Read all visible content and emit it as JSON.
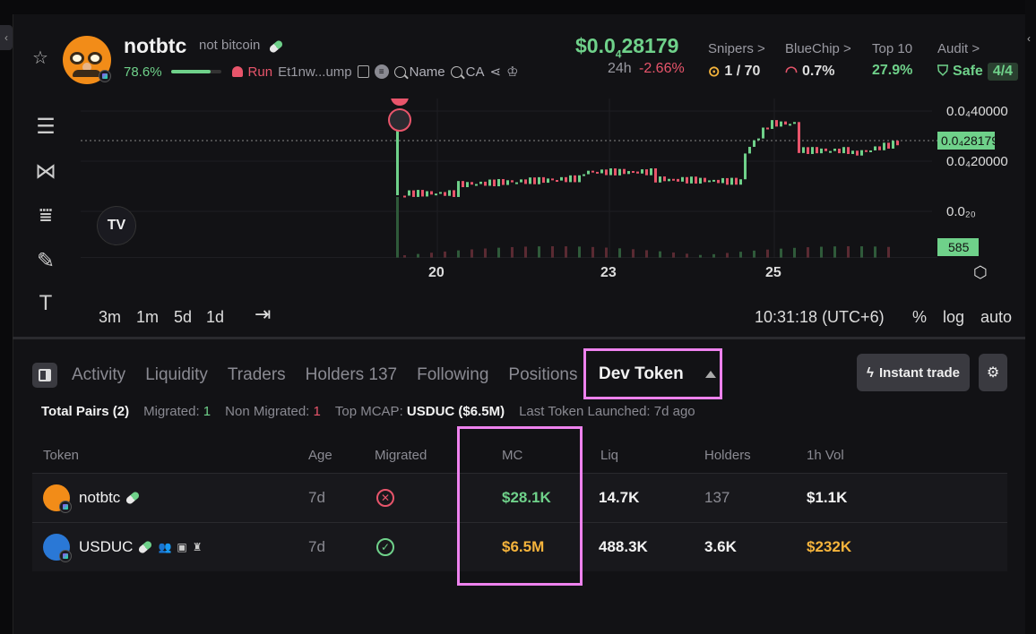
{
  "header": {
    "name": "notbtc",
    "subtitle": "not bitcoin",
    "bonding_pct": "78.6%",
    "bonding_value": 0.786,
    "run_label": "Run",
    "address": "Et1nw...ump",
    "name_search": "Name",
    "ca_search": "CA",
    "price_prefix": "$0.0",
    "price_sub": "4",
    "price_suffix": "28179",
    "change_label": "24h",
    "change": "-2.66%",
    "stats": {
      "snipers_label": "Snipers >",
      "snipers_val": "1 / 70",
      "bluechip_label": "BlueChip >",
      "bluechip_val": "0.7%",
      "top10_label": "Top 10",
      "top10_val": "27.9%",
      "audit_label": "Audit >",
      "audit_val": "Safe",
      "audit_badge": "4/4"
    }
  },
  "chart": {
    "y_ticks": [
      "0.0₄40000",
      "0.0₄20000",
      "0.0₂₀"
    ],
    "current_price_tag": "0.0₄28179",
    "volume_tag": "585",
    "x_ticks": [
      "20",
      "23",
      "25"
    ],
    "timeframes": [
      "3m",
      "1m",
      "5d",
      "1d"
    ],
    "clock": "10:31:18 (UTC+6)",
    "scale_opts": [
      "%",
      "log",
      "auto"
    ]
  },
  "tabs": {
    "items": [
      "Activity",
      "Liquidity",
      "Traders",
      "Holders 137",
      "Following",
      "Positions"
    ],
    "active": "Dev Token",
    "instant_trade": "Instant trade"
  },
  "summary": {
    "total_pairs": "Total Pairs (2)",
    "migrated_label": "Migrated:",
    "migrated_val": "1",
    "non_migrated_label": "Non Migrated:",
    "non_migrated_val": "1",
    "top_mcap_label": "Top MCAP:",
    "top_mcap_val": "USDUC ($6.5M)",
    "last_launched": "Last Token Launched: 7d ago"
  },
  "table": {
    "headers": [
      "Token",
      "Age",
      "Migrated",
      "MC",
      "Liq",
      "Holders",
      "1h Vol"
    ],
    "rows": [
      {
        "token": "notbtc",
        "age": "7d",
        "migrated": false,
        "mc": "$28.1K",
        "liq": "14.7K",
        "holders": "137",
        "vol": "$1.1K"
      },
      {
        "token": "USDUC",
        "age": "7d",
        "migrated": true,
        "mc": "$6.5M",
        "liq": "488.3K",
        "holders": "3.6K",
        "vol": "$232K"
      }
    ]
  },
  "colors": {
    "green": "#6fd18a",
    "red": "#e8556b",
    "orange": "#f5b43c",
    "highlight": "#ee82ee"
  },
  "chart_data": {
    "type": "line",
    "title": "",
    "x": [
      "20",
      "23",
      "25"
    ],
    "y_ticks": [
      "0.0₄40000",
      "0.0₄20000",
      "0.0₂₀"
    ],
    "current_price": "0.0₄28179",
    "volume_last": 585
  }
}
